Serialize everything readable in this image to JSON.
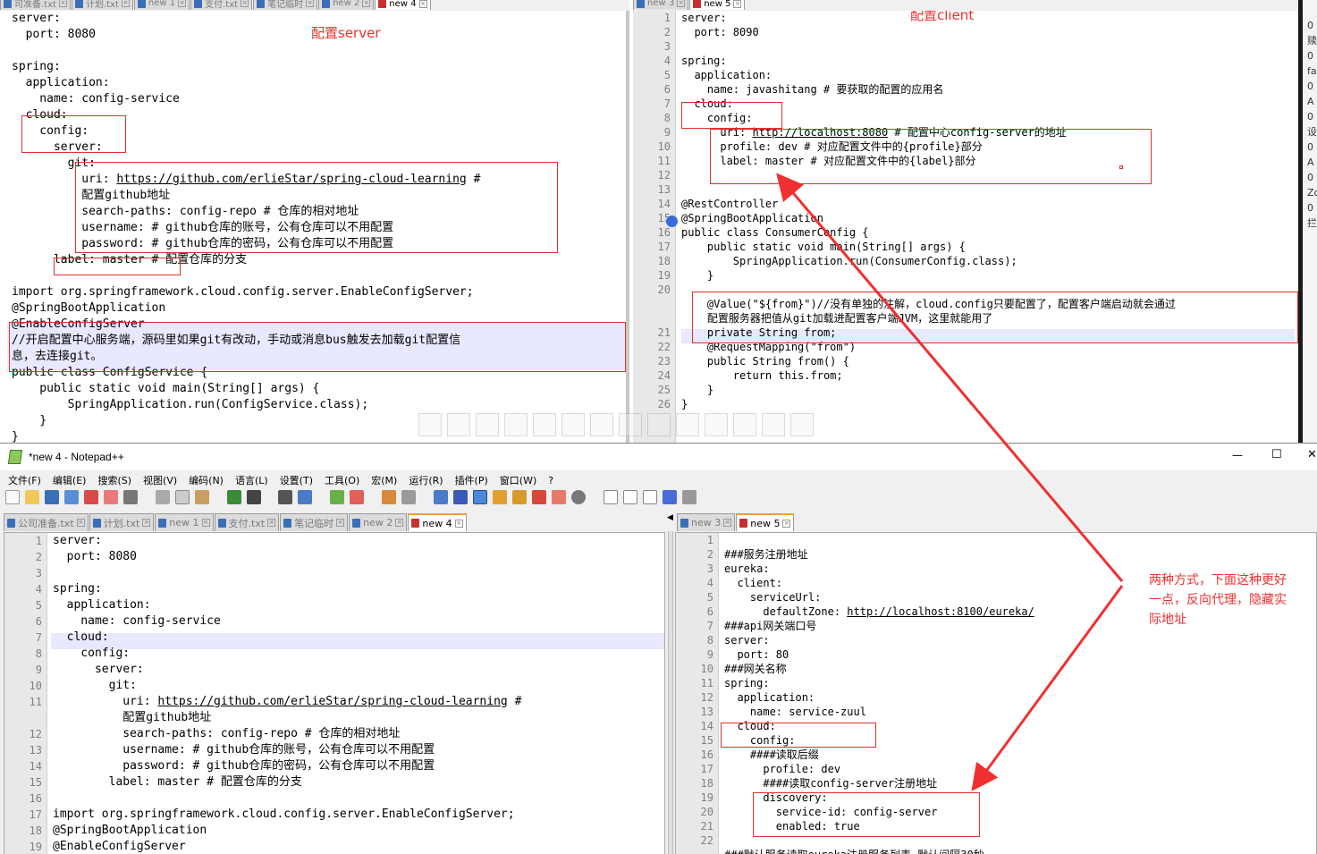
{
  "top_left": {
    "tabs": [
      "司准备.txt",
      "计划.txt",
      "new 1",
      "支付.txt",
      "笔记临时",
      "new 2",
      "new 4"
    ],
    "annotation": "配置server",
    "lines": [
      "server:",
      "  port: 8080",
      "",
      "spring:",
      "  application:",
      "    name: config-service",
      "  cloud:",
      "    config:",
      "      server:",
      "        git:",
      "          uri: https://github.com/erlieStar/spring-cloud-learning #",
      "          配置github地址",
      "          search-paths: config-repo # 仓库的相对地址",
      "          username: # github仓库的账号，公有仓库可以不用配置",
      "          password: # github仓库的密码，公有仓库可以不用配置",
      "      label: master # 配置仓库的分支",
      "",
      "import org.springframework.cloud.config.server.EnableConfigServer;",
      "@SpringBootApplication",
      "@EnableConfigServer",
      "//开启配置中心服务端，源码里如果git有改动，手动或消息bus触发去加载git配置信",
      "息，去连接git。",
      "public class ConfigService {",
      "    public static void main(String[] args) {",
      "        SpringApplication.run(ConfigService.class);",
      "    }",
      "}"
    ]
  },
  "top_right": {
    "tabs": [
      "new 3",
      "new 5"
    ],
    "annotation": "配置client",
    "lines": [
      {
        "n": "1",
        "t": "server:"
      },
      {
        "n": "2",
        "t": "  port: 8090"
      },
      {
        "n": "3",
        "t": ""
      },
      {
        "n": "4",
        "t": "spring:"
      },
      {
        "n": "5",
        "t": "  application:"
      },
      {
        "n": "6",
        "t": "    name: javashitang # 要获取的配置的应用名"
      },
      {
        "n": "7",
        "t": "  cloud:"
      },
      {
        "n": "8",
        "t": "    config:"
      },
      {
        "n": "9",
        "t": "      uri: http://localhost:8080 # 配置中心config-server的地址"
      },
      {
        "n": "10",
        "t": "      profile: dev # 对应配置文件中的{profile}部分"
      },
      {
        "n": "11",
        "t": "      label: master # 对应配置文件中的{label}部分"
      },
      {
        "n": "12",
        "t": ""
      },
      {
        "n": "13",
        "t": ""
      },
      {
        "n": "14",
        "t": "@RestController"
      },
      {
        "n": "15",
        "t": "@SpringBootApplication"
      },
      {
        "n": "16",
        "t": "public class ConsumerConfig {"
      },
      {
        "n": "17",
        "t": "    public static void main(String[] args) {"
      },
      {
        "n": "18",
        "t": "        SpringApplication.run(ConsumerConfig.class);"
      },
      {
        "n": "19",
        "t": "    }"
      },
      {
        "n": "20",
        "t": ""
      },
      {
        "n": "",
        "t": "    @Value(\"${from}\")//没有单独的注解，cloud.config只要配置了，配置客户端启动就会通过"
      },
      {
        "n": "",
        "t": "    配置服务器把值从git加载进配置客户端JVM，这里就能用了"
      },
      {
        "n": "21",
        "t": "    private String from;"
      },
      {
        "n": "22",
        "t": "    @RequestMapping(\"from\")"
      },
      {
        "n": "23",
        "t": "    public String from() {"
      },
      {
        "n": "24",
        "t": "        return this.from;"
      },
      {
        "n": "25",
        "t": "    }"
      },
      {
        "n": "26",
        "t": "}"
      }
    ]
  },
  "side_strip": [
    "0",
    "赎",
    "0",
    "fa",
    "0",
    "A",
    "0",
    "设",
    "0",
    "A",
    "0",
    "Zo",
    "0",
    "拦"
  ],
  "window": {
    "title": "*new 4 - Notepad++",
    "min": "—",
    "max": "☐",
    "close": "✕",
    "menu": [
      "文件(F)",
      "编辑(E)",
      "搜索(S)",
      "视图(V)",
      "编码(N)",
      "语言(L)",
      "设置(T)",
      "工具(O)",
      "宏(M)",
      "运行(R)",
      "插件(P)",
      "窗口(W)",
      "?"
    ]
  },
  "bottom_left": {
    "tabs": [
      "公司准备.txt",
      "计划.txt",
      "new 1",
      "支付.txt",
      "笔记临时",
      "new 2",
      "new 4"
    ],
    "lines": [
      {
        "n": "1",
        "t": "server:"
      },
      {
        "n": "2",
        "t": "  port: 8080"
      },
      {
        "n": "3",
        "t": ""
      },
      {
        "n": "4",
        "t": "spring:"
      },
      {
        "n": "5",
        "t": "  application:"
      },
      {
        "n": "6",
        "t": "    name: config-service"
      },
      {
        "n": "7",
        "t": "  cloud:"
      },
      {
        "n": "8",
        "t": "    config:"
      },
      {
        "n": "9",
        "t": "      server:"
      },
      {
        "n": "10",
        "t": "        git:"
      },
      {
        "n": "11",
        "t": "          uri: https://github.com/erlieStar/spring-cloud-learning #"
      },
      {
        "n": "",
        "t": "          配置github地址"
      },
      {
        "n": "12",
        "t": "          search-paths: config-repo # 仓库的相对地址"
      },
      {
        "n": "13",
        "t": "          username: # github仓库的账号，公有仓库可以不用配置"
      },
      {
        "n": "14",
        "t": "          password: # github仓库的密码，公有仓库可以不用配置"
      },
      {
        "n": "15",
        "t": "        label: master # 配置仓库的分支"
      },
      {
        "n": "16",
        "t": ""
      },
      {
        "n": "17",
        "t": "import org.springframework.cloud.config.server.EnableConfigServer;"
      },
      {
        "n": "18",
        "t": "@SpringBootApplication"
      },
      {
        "n": "19",
        "t": "@EnableConfigServer"
      }
    ]
  },
  "bottom_right": {
    "tabs": [
      "new 3",
      "new 5"
    ],
    "annotation": [
      "两种方式，下面这种更好",
      "一点，反向代理，隐藏实",
      "际地址"
    ],
    "lines": [
      {
        "n": "1",
        "t": ""
      },
      {
        "n": "2",
        "t": "###服务注册地址"
      },
      {
        "n": "3",
        "t": "eureka:"
      },
      {
        "n": "4",
        "t": "  client:"
      },
      {
        "n": "5",
        "t": "    serviceUrl:"
      },
      {
        "n": "6",
        "t": "      defaultZone: http://localhost:8100/eureka/"
      },
      {
        "n": "7",
        "t": "###api网关端口号"
      },
      {
        "n": "8",
        "t": "server:"
      },
      {
        "n": "9",
        "t": "  port: 80"
      },
      {
        "n": "10",
        "t": "###网关名称"
      },
      {
        "n": "11",
        "t": "spring:"
      },
      {
        "n": "12",
        "t": "  application:"
      },
      {
        "n": "13",
        "t": "    name: service-zuul"
      },
      {
        "n": "14",
        "t": "  cloud:"
      },
      {
        "n": "15",
        "t": "    config:"
      },
      {
        "n": "16",
        "t": "    ####读取后缀"
      },
      {
        "n": "17",
        "t": "      profile: dev"
      },
      {
        "n": "18",
        "t": "      ####读取config-server注册地址"
      },
      {
        "n": "19",
        "t": "      discovery:"
      },
      {
        "n": "20",
        "t": "        service-id: config-server"
      },
      {
        "n": "21",
        "t": "        enabled: true"
      },
      {
        "n": "22",
        "t": ""
      },
      {
        "n": "",
        "t": "###默认服务读取eureka注册服务列表 默认间隔30秒"
      }
    ]
  },
  "colors": {
    "annotation": "#f03030",
    "tab_accent": "#f7a030",
    "line_highlight": "#e8e8ff"
  }
}
